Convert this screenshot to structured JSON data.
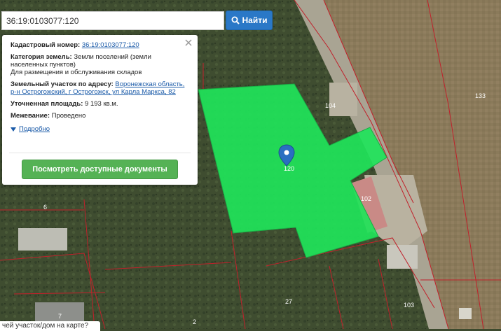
{
  "search": {
    "value": "36:19:0103077:120",
    "button_label": "Найти"
  },
  "popup": {
    "cadastral_label": "Кадастровый номер:",
    "cadastral_value": "36:19:0103077:120",
    "category_label": "Категория земель:",
    "category_value_line1": "Земли поселений (земли",
    "category_value_line2": "населенных пунктов)",
    "category_use": "Для размещения и обслуживания складов",
    "address_label": "Земельный участок по адресу:",
    "address_line1": "Воронежская область,",
    "address_line2": "р-н Острогожский, г Острогожск, ул Карла Маркса, 82",
    "area_label": "Уточненная площадь:",
    "area_value": "9 193 кв.м.",
    "survey_label": "Межевание:",
    "survey_value": "Проведено",
    "more_label": "Подробно",
    "docs_button": "Посмотреть доступные документы"
  },
  "map": {
    "parcel_number": "120",
    "labels": [
      "104",
      "133",
      "102",
      "6",
      "27",
      "103",
      "7",
      "2"
    ],
    "parcel_color": "#1fe45a",
    "boundary_color": "#c0212b"
  },
  "bottom_text": "чей участок/дом на карте?"
}
